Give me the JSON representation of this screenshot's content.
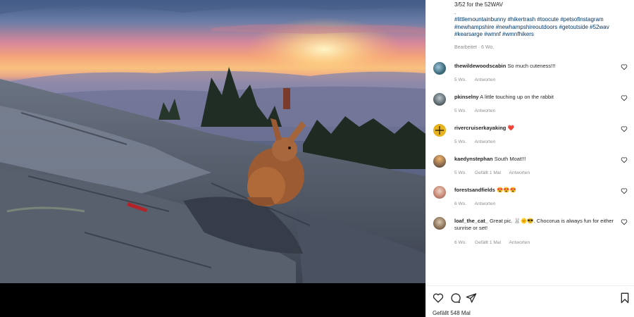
{
  "post": {
    "caption_line": "3/52 for the 52WAV",
    "caption_dot": ".",
    "hashtags": "#littlemountainbunny #hikertrash #toocute #petsofinstagram #newhampshire #newhampshireoutdoors #getoutside #52wav #kearsarge #wmnf #wmnfhikers",
    "edited": "Bearbeitet · 6 Wo."
  },
  "comments": [
    {
      "user": "thewildewoodscabin",
      "text": "So much cuteness!!!",
      "age": "5 Wo.",
      "likes": "",
      "reply": "Antworten"
    },
    {
      "user": "pkinselny",
      "text": "A little touching up on the rabbit",
      "age": "5 Wo.",
      "likes": "",
      "reply": "Antworten"
    },
    {
      "user": "rivercruiserkayaking",
      "text": "❤️",
      "age": "5 Wo.",
      "likes": "",
      "reply": "Antworten"
    },
    {
      "user": "kaedynstephan",
      "text": "South Moat!!!",
      "age": "5 Wo.",
      "likes": "Gefällt 1 Mal",
      "reply": "Antworten"
    },
    {
      "user": "forestsandfields",
      "text": "😍😍😍",
      "age": "6 Wo.",
      "likes": "",
      "reply": "Antworten"
    },
    {
      "user": "loaf_the_cat_",
      "text": "Great pic. 🐰🌞😎. Chocorua is always fun for either sunrise or set!",
      "age": "6 Wo.",
      "likes": "Gefällt 1 Mal",
      "reply": "Antworten"
    }
  ],
  "footer": {
    "likes_label": "Gefällt 548 Mal"
  },
  "icons": {
    "like": "heart-icon",
    "comment": "comment-icon",
    "share": "send-icon",
    "save": "bookmark-icon"
  }
}
